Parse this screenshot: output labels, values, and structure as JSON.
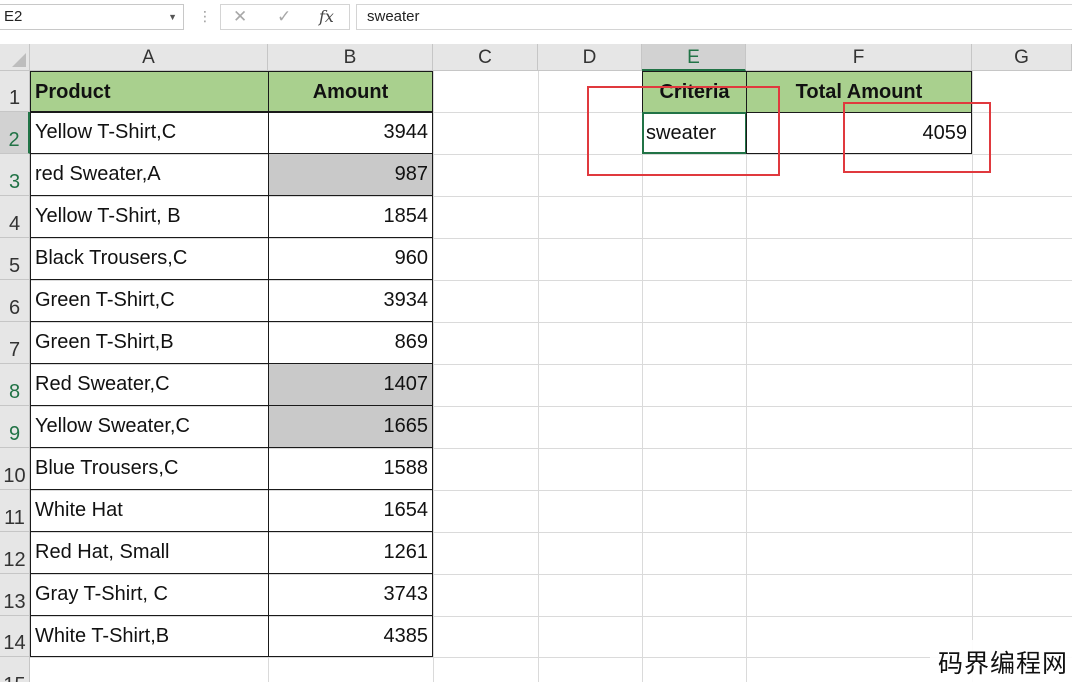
{
  "formula_bar": {
    "name_box": "E2",
    "formula": "sweater",
    "cancel_icon": "✕",
    "enter_icon": "✓",
    "fx_label": "fx"
  },
  "columns": [
    "A",
    "B",
    "C",
    "D",
    "E",
    "F",
    "G"
  ],
  "rows": [
    "1",
    "2",
    "3",
    "4",
    "5",
    "6",
    "7",
    "8",
    "9",
    "10",
    "11",
    "12",
    "13",
    "14",
    "15"
  ],
  "table": {
    "headers": [
      "Product",
      "Amount"
    ],
    "rows": [
      {
        "product": "Yellow T-Shirt,C",
        "amount": "3944",
        "highlighted": false
      },
      {
        "product": "red Sweater,A",
        "amount": "987",
        "highlighted": true
      },
      {
        "product": "Yellow T-Shirt, B",
        "amount": "1854",
        "highlighted": false
      },
      {
        "product": "Black Trousers,C",
        "amount": "960",
        "highlighted": false
      },
      {
        "product": "Green T-Shirt,C",
        "amount": "3934",
        "highlighted": false
      },
      {
        "product": "Green T-Shirt,B",
        "amount": "869",
        "highlighted": false
      },
      {
        "product": "Red Sweater,C",
        "amount": "1407",
        "highlighted": true
      },
      {
        "product": "Yellow Sweater,C",
        "amount": "1665",
        "highlighted": true
      },
      {
        "product": "Blue Trousers,C",
        "amount": "1588",
        "highlighted": false
      },
      {
        "product": "White Hat",
        "amount": "1654",
        "highlighted": false
      },
      {
        "product": "Red Hat, Small",
        "amount": "1261",
        "highlighted": false
      },
      {
        "product": "Gray T-Shirt, C",
        "amount": "3743",
        "highlighted": false
      },
      {
        "product": "White T-Shirt,B",
        "amount": "4385",
        "highlighted": false
      }
    ]
  },
  "summary": {
    "criteria_header": "Criteria",
    "total_header": "Total Amount",
    "criteria_value": "sweater",
    "total_value": "4059"
  },
  "watermark": "码界编程网",
  "colors": {
    "header_fill": "#a9d08e",
    "highlight_fill": "#c9c9c9",
    "selection": "#217346",
    "annotation": "#e0393e"
  }
}
